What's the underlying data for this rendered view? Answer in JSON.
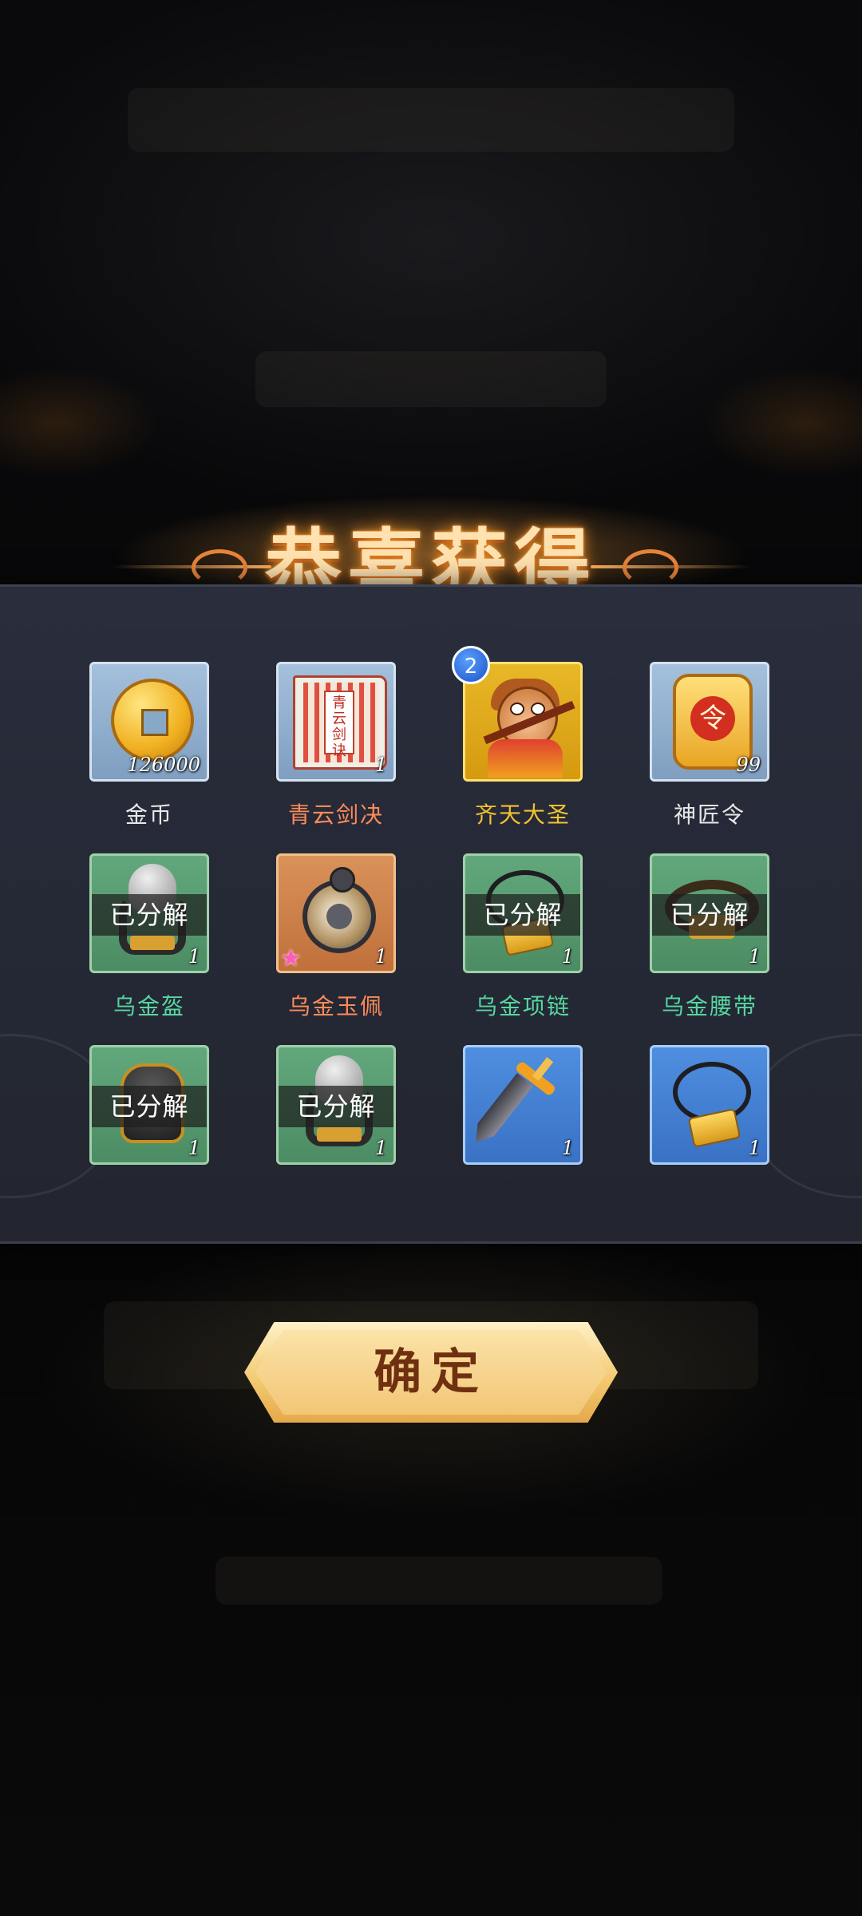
{
  "dialog": {
    "title": "恭喜获得",
    "confirm_label": "确定",
    "decomposed_label": "已分解"
  },
  "items": [
    {
      "name": "金币",
      "count": "126000",
      "quality": "blue",
      "name_color": "#e8e8e8",
      "icon": "gold-coin-icon",
      "decomposed": false
    },
    {
      "name": "青云剑决",
      "count": "1",
      "quality": "blue",
      "name_color": "#ff8c58",
      "icon": "scroll-book-icon",
      "decomposed": false,
      "icon_text": "青云剑诀"
    },
    {
      "name": "齐天大圣",
      "count": "",
      "quality": "gold",
      "name_color": "#f2c230",
      "icon": "monkey-king-hero-icon",
      "decomposed": false,
      "badge": "2"
    },
    {
      "name": "神匠令",
      "count": "99",
      "quality": "blue",
      "name_color": "#e8e8e8",
      "icon": "token-plaque-icon",
      "decomposed": false
    },
    {
      "name": "乌金盔",
      "count": "1",
      "quality": "green",
      "name_color": "#58d6a0",
      "icon": "helmet-icon",
      "decomposed": true
    },
    {
      "name": "乌金玉佩",
      "count": "1",
      "quality": "orange",
      "name_color": "#ff8c58",
      "icon": "jade-pendant-icon",
      "decomposed": false,
      "star": true
    },
    {
      "name": "乌金项链",
      "count": "1",
      "quality": "green",
      "name_color": "#58d6a0",
      "icon": "necklace-icon",
      "decomposed": true
    },
    {
      "name": "乌金腰带",
      "count": "1",
      "quality": "green",
      "name_color": "#58d6a0",
      "icon": "belt-icon",
      "decomposed": true
    },
    {
      "name": "",
      "count": "1",
      "quality": "green",
      "name_color": "#58d6a0",
      "icon": "armor-icon",
      "decomposed": true
    },
    {
      "name": "",
      "count": "1",
      "quality": "green",
      "name_color": "#58d6a0",
      "icon": "helmet-icon",
      "decomposed": true
    },
    {
      "name": "",
      "count": "1",
      "quality": "light-blue",
      "name_color": "#e8e8e8",
      "icon": "sword-icon",
      "decomposed": false
    },
    {
      "name": "",
      "count": "1",
      "quality": "light-blue",
      "name_color": "#e8e8e8",
      "icon": "necklace-icon",
      "decomposed": false
    }
  ],
  "colors": {
    "title": "#ffe2b0",
    "panel": "#262a36",
    "confirm_text": "#6e3010"
  }
}
